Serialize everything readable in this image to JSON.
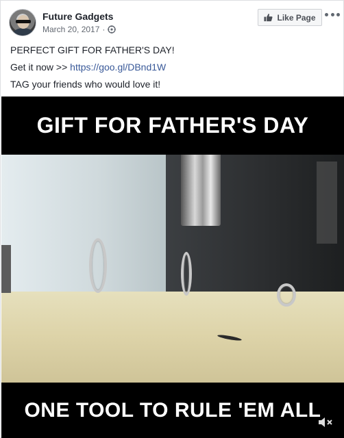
{
  "post": {
    "page_name": "Future Gadgets",
    "date": "March 20, 2017",
    "separator": "·",
    "like_page_label": "Like Page",
    "text": {
      "line1": "PERFECT GIFT FOR FATHER'S DAY!",
      "line2_prefix": "Get it now >> ",
      "line2_link": "https://goo.gl/DBnd1W",
      "line3": "TAG your friends who would love it!"
    }
  },
  "media": {
    "caption_top": "GIFT FOR FATHER'S DAY",
    "caption_bottom": "ONE TOOL TO RULE 'EM ALL"
  },
  "icons": {
    "privacy": "globe-icon",
    "like": "thumb-icon",
    "more": "more-icon",
    "mute": "mute-icon"
  },
  "colors": {
    "link": "#385898",
    "meta_text": "#616770",
    "caption_bg": "#000000",
    "caption_text": "#ffffff"
  }
}
